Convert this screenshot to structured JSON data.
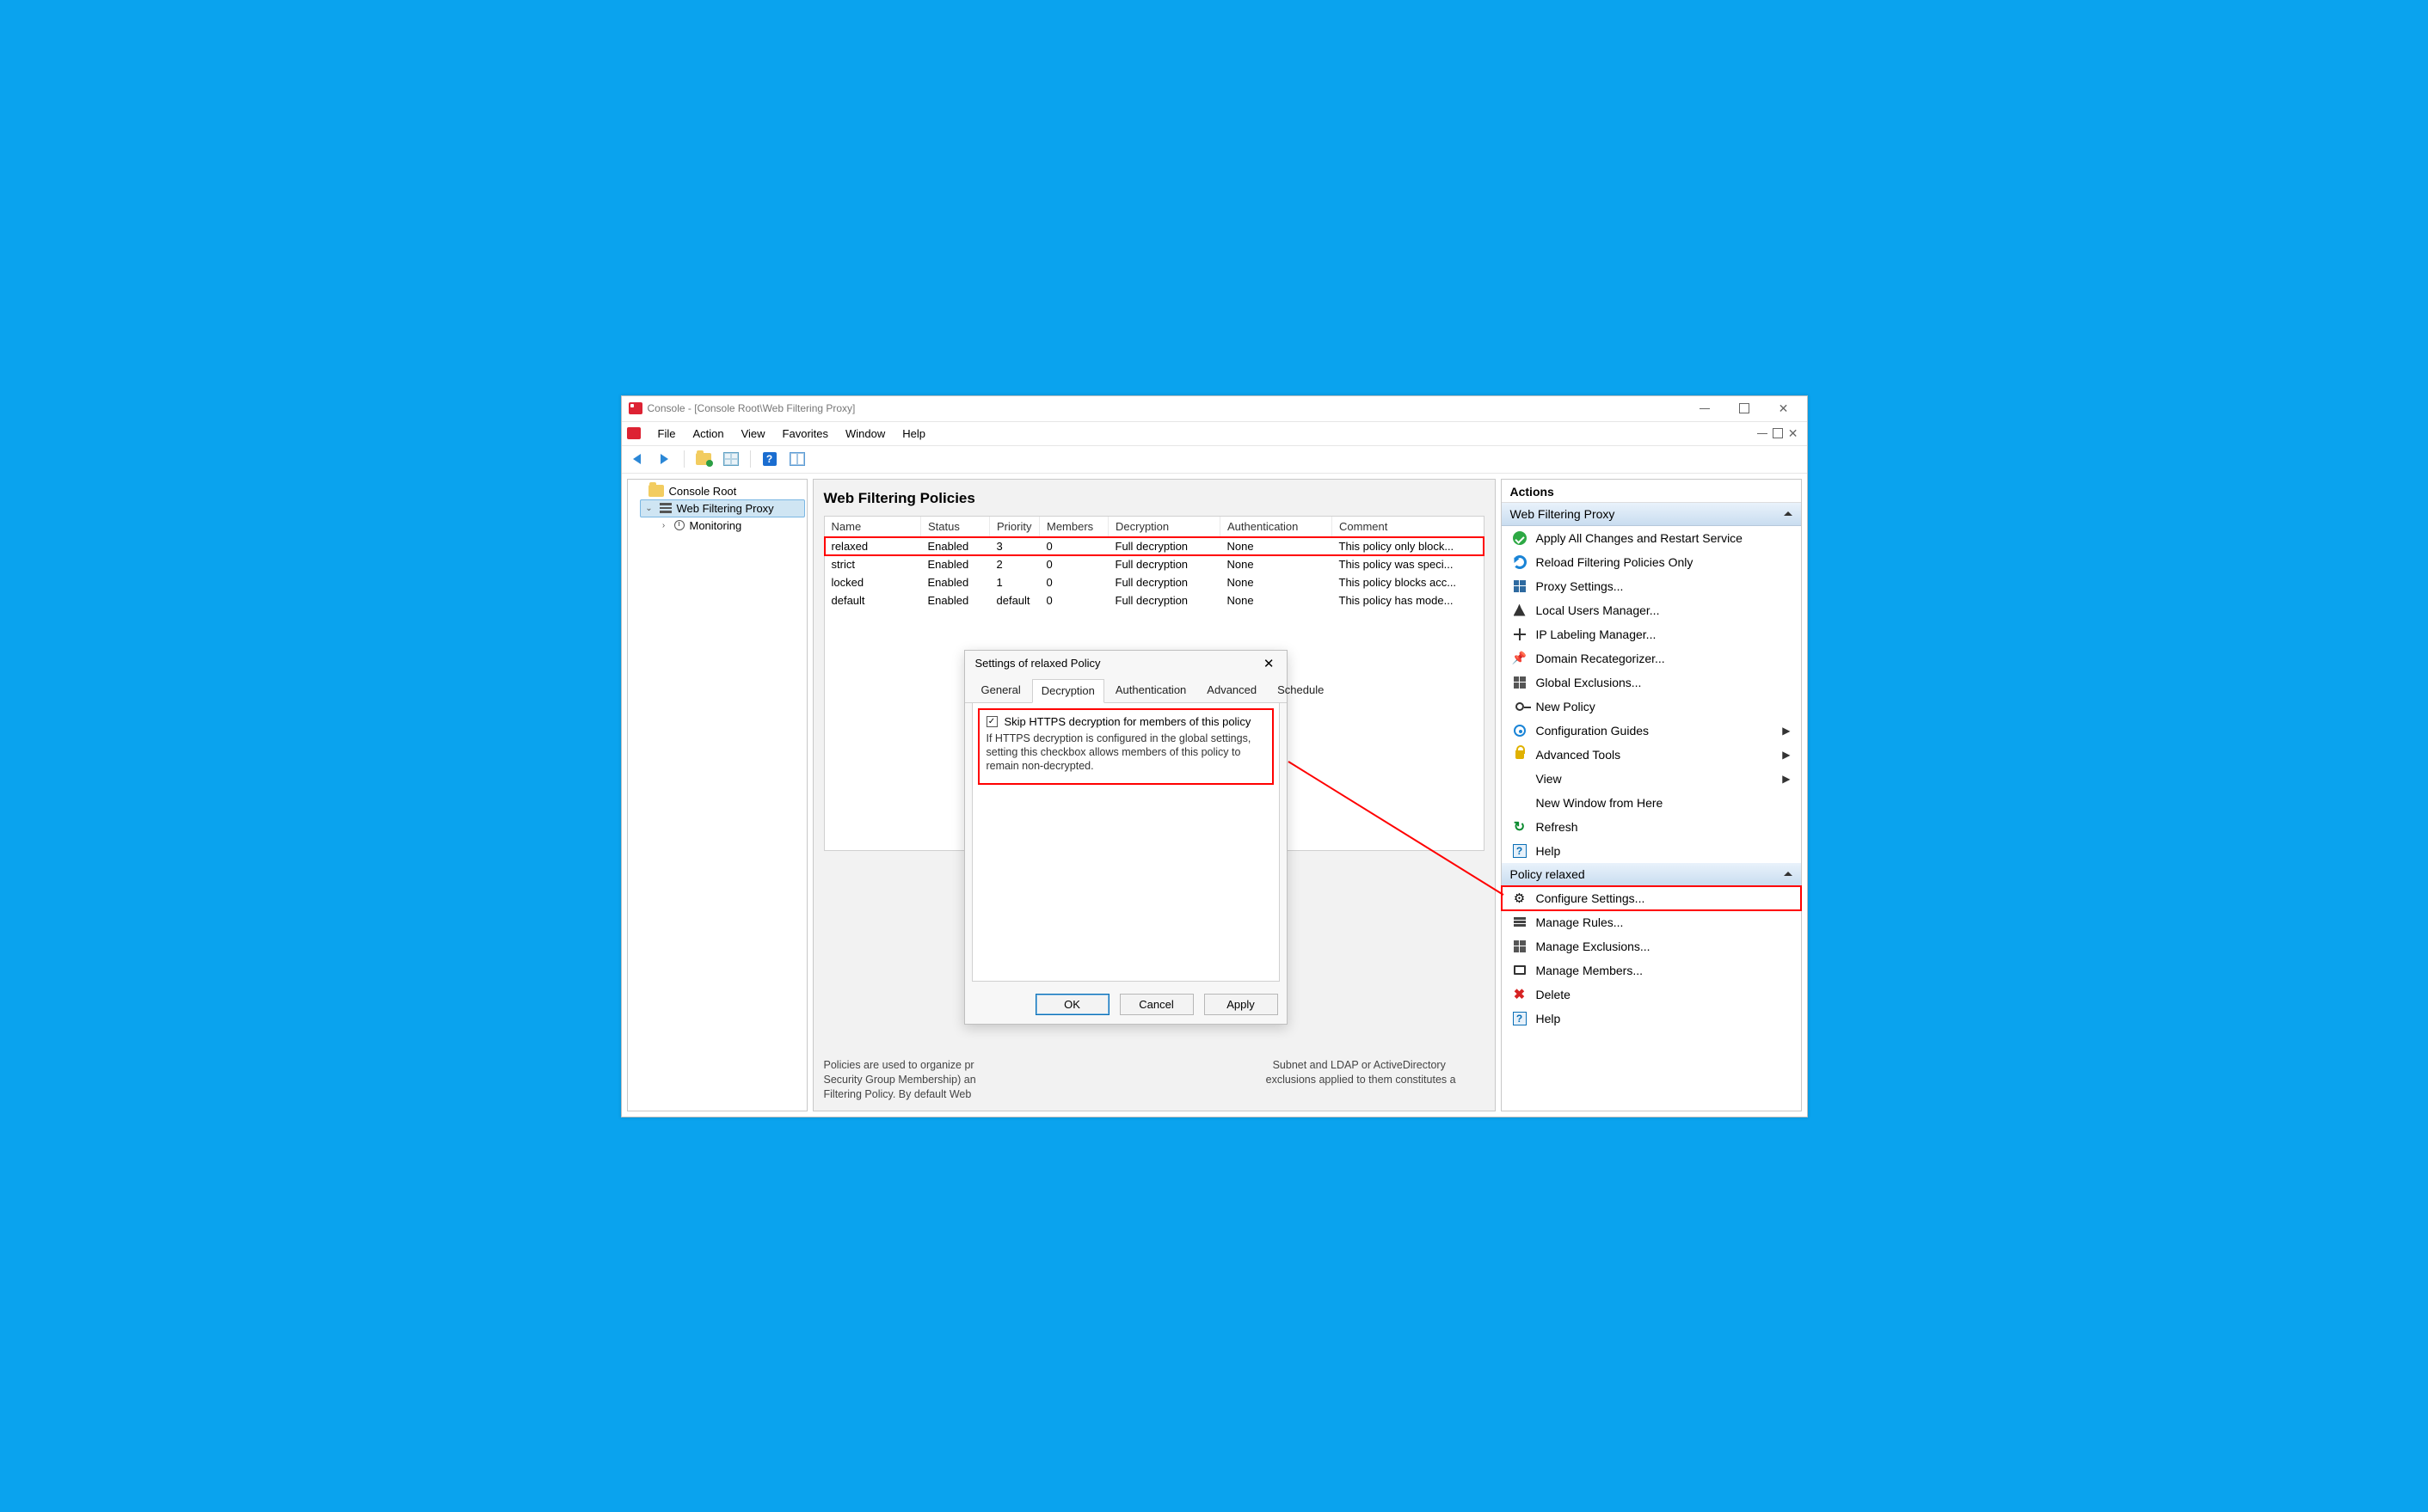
{
  "window": {
    "title": "Console - [Console Root\\Web Filtering Proxy]"
  },
  "menubar": {
    "items": [
      "File",
      "Action",
      "View",
      "Favorites",
      "Window",
      "Help"
    ]
  },
  "tree": {
    "root": "Console Root",
    "proxy": "Web Filtering Proxy",
    "monitoring": "Monitoring"
  },
  "center": {
    "heading": "Web Filtering Policies",
    "columns": [
      "Name",
      "Status",
      "Priority",
      "Members",
      "Decryption",
      "Authentication",
      "Comment"
    ],
    "rows": [
      {
        "name": "relaxed",
        "status": "Enabled",
        "priority": "3",
        "members": "0",
        "decryption": "Full decryption",
        "auth": "None",
        "comment": "This policy only block...",
        "hl": true
      },
      {
        "name": "strict",
        "status": "Enabled",
        "priority": "2",
        "members": "0",
        "decryption": "Full decryption",
        "auth": "None",
        "comment": "This policy was speci...",
        "hl": false
      },
      {
        "name": "locked",
        "status": "Enabled",
        "priority": "1",
        "members": "0",
        "decryption": "Full decryption",
        "auth": "None",
        "comment": "This policy blocks acc...",
        "hl": false
      },
      {
        "name": "default",
        "status": "Enabled",
        "priority": "default",
        "members": "0",
        "decryption": "Full decryption",
        "auth": "None",
        "comment": "This policy has mode...",
        "hl": false
      }
    ],
    "desc_left": "Policies are used to organize pr",
    "desc_mid_a": "Security Group Membership) an",
    "desc_mid_b": "Filtering Policy. By default Web",
    "desc_right_a": "Subnet and LDAP or ActiveDirectory",
    "desc_right_b": "exclusions applied to them constitutes a"
  },
  "actions": {
    "title": "Actions",
    "section1": "Web Filtering Proxy",
    "items1": [
      {
        "id": "apply",
        "label": "Apply All Changes and Restart Service",
        "icon": "ai-check"
      },
      {
        "id": "reload",
        "label": "Reload Filtering Policies Only",
        "icon": "ai-reload"
      },
      {
        "id": "proxysettings",
        "label": "Proxy Settings...",
        "icon": "ai-grid"
      },
      {
        "id": "localusers",
        "label": "Local Users Manager...",
        "icon": "ai-user"
      },
      {
        "id": "iplabel",
        "label": "IP Labeling Manager...",
        "icon": "ai-net"
      },
      {
        "id": "domainrecat",
        "label": "Domain Recategorizer...",
        "icon": "ai-star"
      },
      {
        "id": "globalexcl",
        "label": "Global Exclusions...",
        "icon": "ai-ex"
      },
      {
        "id": "newpolicy",
        "label": "New Policy",
        "icon": "ai-key"
      },
      {
        "id": "confguides",
        "label": "Configuration Guides",
        "icon": "ai-guide",
        "sub": true
      },
      {
        "id": "advtools",
        "label": "Advanced Tools",
        "icon": "ai-lock",
        "sub": true
      },
      {
        "id": "view",
        "label": "View",
        "icon": "",
        "sub": true
      },
      {
        "id": "newwin",
        "label": "New Window from Here",
        "icon": ""
      },
      {
        "id": "refresh",
        "label": "Refresh",
        "icon": "ai-refresh"
      },
      {
        "id": "help1",
        "label": "Help",
        "icon": "ai-q"
      }
    ],
    "section2": "Policy relaxed",
    "items2": [
      {
        "id": "configset",
        "label": "Configure Settings...",
        "icon": "ai-gear",
        "red": true
      },
      {
        "id": "mrules",
        "label": "Manage Rules...",
        "icon": "ai-rules"
      },
      {
        "id": "mexcl",
        "label": "Manage Exclusions...",
        "icon": "ai-ex"
      },
      {
        "id": "mmembers",
        "label": "Manage Members...",
        "icon": "ai-mon"
      },
      {
        "id": "delete",
        "label": "Delete",
        "icon": "ai-del"
      },
      {
        "id": "help2",
        "label": "Help",
        "icon": "ai-q"
      }
    ]
  },
  "dialog": {
    "title": "Settings of relaxed Policy",
    "tabs": [
      "General",
      "Decryption",
      "Authentication",
      "Advanced",
      "Schedule"
    ],
    "active_tab": 1,
    "checkbox_label": "Skip HTTPS decryption for members of this policy",
    "checkbox_checked": true,
    "desc": "If HTTPS decryption is configured in the global settings, setting this checkbox allows members of this policy to remain non-decrypted.",
    "buttons": {
      "ok": "OK",
      "cancel": "Cancel",
      "apply": "Apply"
    }
  }
}
